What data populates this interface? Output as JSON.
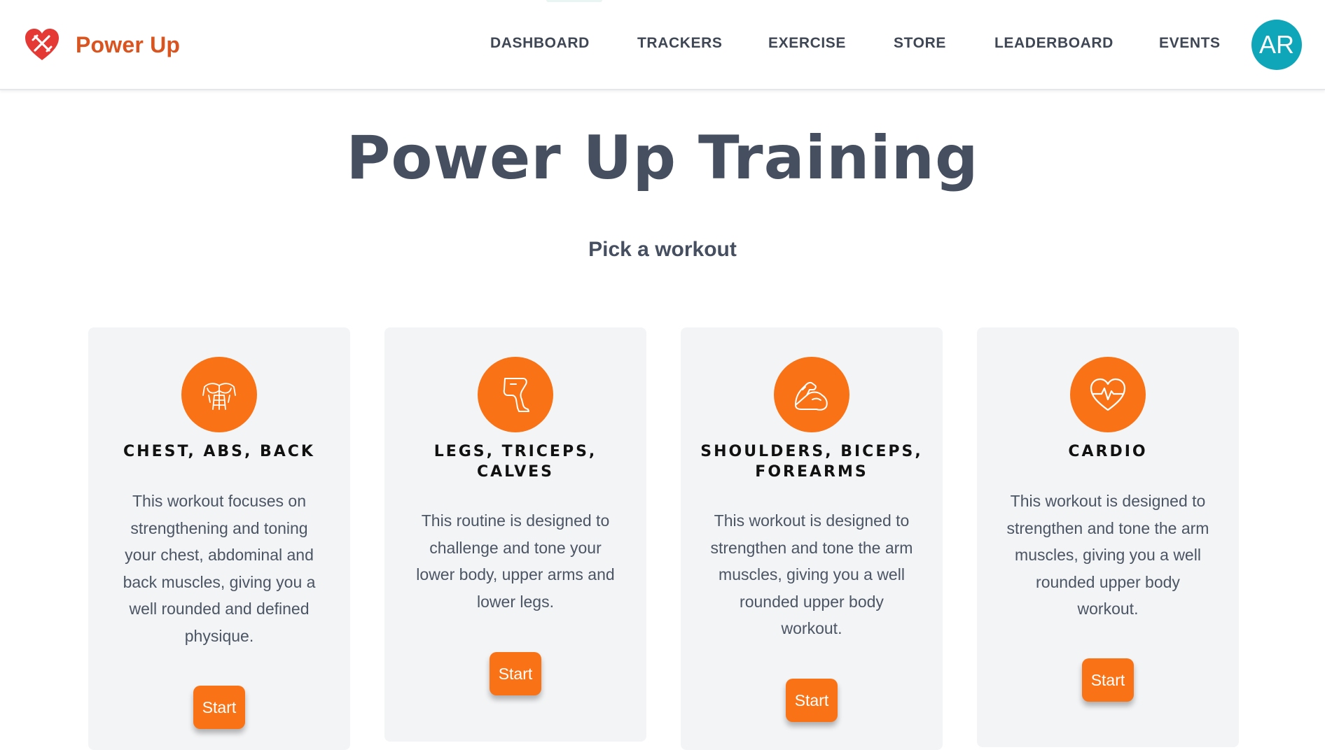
{
  "brand": {
    "name": "Power Up",
    "logo_icon": "heart-dumbbell-logo",
    "color": "#d9541e"
  },
  "nav": {
    "items": [
      "DASHBOARD",
      "TRACKERS",
      "EXERCISE",
      "STORE",
      "LEADERBOARD",
      "EVENTS"
    ],
    "avatar_initials": "AR",
    "avatar_color": "#10a6b9"
  },
  "hero": {
    "title": "Power Up Training",
    "subtitle": "Pick a workout"
  },
  "colors": {
    "accent": "#f97316",
    "card_bg": "#f3f4f6",
    "heading": "#464f60"
  },
  "workouts": [
    {
      "icon": "torso-muscles-icon",
      "title": "CHEST, ABS, BACK",
      "description": "This workout focuses on strengthening and toning your chest, abdominal and back muscles, giving you a well rounded and defined physique.",
      "button": "Start"
    },
    {
      "icon": "leg-icon",
      "title": "LEGS, TRICEPS, CALVES",
      "description": "This routine is designed to challenge and tone your lower body, upper arms and lower legs.",
      "button": "Start"
    },
    {
      "icon": "flexed-bicep-icon",
      "title": "SHOULDERS, BICEPS, FOREARMS",
      "description": "This workout is designed to strengthen and tone the arm muscles, giving you a well rounded upper body workout.",
      "button": "Start"
    },
    {
      "icon": "heart-pulse-icon",
      "title": "CARDIO",
      "description": "This workout is designed to strengthen and tone the arm muscles, giving you a well rounded upper body workout.",
      "button": "Start"
    }
  ]
}
